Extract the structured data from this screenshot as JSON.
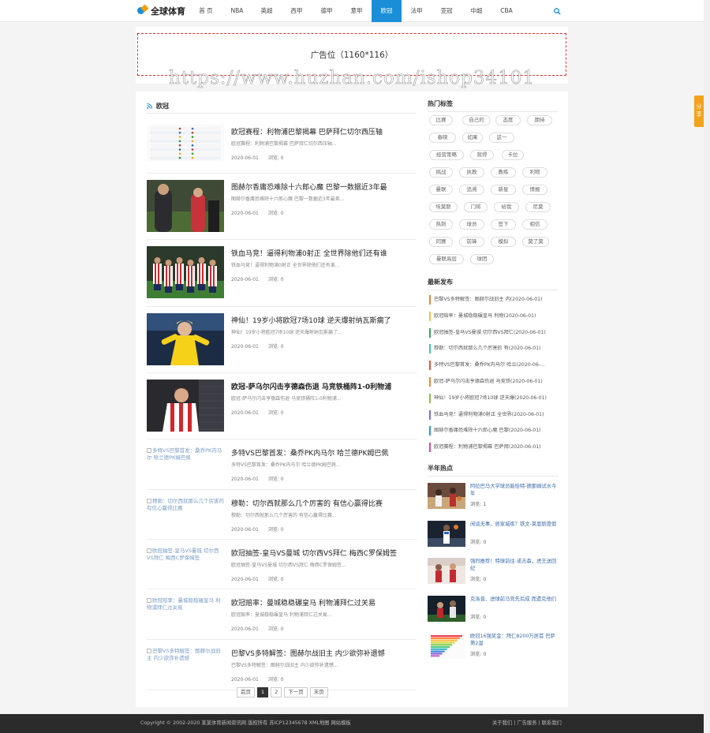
{
  "header": {
    "logo_text": "全球体育",
    "nav": [
      "首 页",
      "NBA",
      "英超",
      "西甲",
      "德甲",
      "意甲",
      "欧冠",
      "法甲",
      "亚冠",
      "中超",
      "CBA"
    ],
    "active_nav": "欧冠"
  },
  "ad": {
    "label": "广告位（1160*116）"
  },
  "watermark": "https://www.huzhan.com/ishop34101",
  "section": {
    "title": "欧冠"
  },
  "posts": [
    {
      "title": "欧冠赛程：利物浦巴黎揭幕 巴萨拜仁切尔西压轴",
      "desc": "欧冠赛程：利物浦巴黎揭幕 巴萨拜仁切尔西压轴...",
      "date": "2020-06-01",
      "views": "浏览: 0",
      "bold": false,
      "image": "table",
      "alt": ""
    },
    {
      "title": "图赫尔香庸恐难除十六郎心魔 巴黎一数据近3年最",
      "desc": "图赫尔香庸恐难除十六郎心魔 巴黎一数据近3年最差...",
      "date": "2020-06-01",
      "views": "浏览: 0",
      "bold": false,
      "image": "coach",
      "alt": ""
    },
    {
      "title": "铁血马竞！逼得利物浦0射正 全世界除他们还有谁",
      "desc": "铁血马竞！逼得利物浦0射正 全世界除他们还有谁...",
      "date": "2020-06-01",
      "views": "浏览: 0",
      "bold": false,
      "image": "team",
      "alt": ""
    },
    {
      "title": "神仙！19岁小将欧冠7场10球 逆天爆射纳瓦斯瘸了",
      "desc": "神仙！19岁小将欧冠7场10球 逆天爆射纳瓦斯瘸了...",
      "date": "2020-06-01",
      "views": "浏览: 0",
      "bold": false,
      "image": "player-yellow",
      "alt": ""
    },
    {
      "title": "欧冠-萨乌尔闪击亨德森伤退 马竞铁桶阵1-0利物浦",
      "desc": "欧冠-萨乌尔闪击亨德森伤退 马竞铁桶阵1-0利物浦...",
      "date": "2020-06-01",
      "views": "浏览: 0",
      "bold": true,
      "image": "player-stripes",
      "alt": ""
    },
    {
      "title": "多特VS巴黎首发：桑乔PK内马尔 哈兰德PK姆巴佩",
      "desc": "多特VS巴黎首发：桑乔PK内马尔 哈兰德PK姆巴佩...",
      "date": "2020-06-01",
      "views": "浏览: 0",
      "bold": false,
      "image": "",
      "alt": "多特VS巴黎首发：桑乔PK内马尔 哈兰德PK姆巴佩"
    },
    {
      "title": "穆勒：切尔西就那么几个厉害的 有信心赢得比赛",
      "desc": "穆勒：切尔西就那么几个厉害的 有信心赢得比赛...",
      "date": "2020-06-01",
      "views": "浏览: 0",
      "bold": false,
      "image": "",
      "alt": "穆勒：切尔西就那么几个厉害的 有信心赢得比赛"
    },
    {
      "title": "欧冠抽签-皇马VS曼城 切尔西VS拜仁 梅西C罗保姆签",
      "desc": "欧冠抽签-皇马VS曼城 切尔西VS拜仁 梅西C罗保姆签...",
      "date": "2020-06-01",
      "views": "浏览: 0",
      "bold": false,
      "image": "",
      "alt": "欧冠抽签-皇马VS曼城 切尔西VS拜仁 梅西C罗保姆签"
    },
    {
      "title": "欧冠赔率：曼城稳稳碾皇马 利物浦拜仁过关易",
      "desc": "欧冠赔率：曼城稳稳碾皇马 利物浦拜仁过关易...",
      "date": "2020-06-01",
      "views": "浏览: 0",
      "bold": false,
      "image": "",
      "alt": "欧冠赔率：曼城稳稳碾皇马 利物浦拜仁过关易"
    },
    {
      "title": "巴黎VS多特解签：图赫尔战旧主 内少欲弥补遗憾",
      "desc": "巴黎VS多特解签：图赫尔战旧主 内少欲弥补遗憾...",
      "date": "2020-06-01",
      "views": "浏览: 0",
      "bold": false,
      "image": "",
      "alt": "巴黎VS多特解签：图赫尔战旧主 内少欲弥补遗憾"
    }
  ],
  "pagination": [
    "首页",
    "1",
    "2",
    "下一页",
    "末页"
  ],
  "sidebar": {
    "tags_title": "热门标签",
    "tags": [
      "比赛",
      "自己的",
      "态度",
      "期待",
      "春晓",
      "如果",
      "这一",
      "经营策略",
      "就得",
      "卡拉",
      "挑战",
      "执教",
      "教练",
      "利物",
      "曼联",
      "追溯",
      "新星",
      "情报",
      "埃莫斯",
      "门将",
      "给我",
      "尼莫",
      "热刺",
      "球员",
      "签下",
      "相信",
      "同赛",
      "前锋",
      "模拟",
      "莫了莫",
      "曼联高层",
      "球团"
    ],
    "latest_title": "最新发布",
    "latest": [
      {
        "text": "巴黎VS多特解签：图赫尔战旧主 内(2020-06-01)",
        "color": "#e9883a"
      },
      {
        "text": "欧冠赔率：曼城稳稳碾皇马 利物(2020-06-01)",
        "color": "#f2c14e"
      },
      {
        "text": "欧冠抽签-皇马VS曼城 切尔西VS拜仁(2020-06-01)",
        "color": "#3aa657"
      },
      {
        "text": "穆勒：切尔西就那么几个厉害的 有(2020-06-01)",
        "color": "#3dbfd1"
      },
      {
        "text": "多特VS巴黎首发：桑乔PK内马尔 哈兰(2020-06-...",
        "color": "#e2543c"
      },
      {
        "text": "欧冠-萨乌尔闪击亨德森伤退 马竞铁(2020-06-01)",
        "color": "#ee8a2f"
      },
      {
        "text": "神仙！19岁小将欧冠7场10球 逆天爆(2020-06-01)",
        "color": "#8bc34a"
      },
      {
        "text": "铁血马竞！逼得利物浦0射正 全世界(2020-06-01)",
        "color": "#7a6fd0"
      },
      {
        "text": "图赫尔香庸恐难除十六郎心魔 巴黎(2020-06-01)",
        "color": "#2d9ad7"
      },
      {
        "text": "欧冠赛程：利物浦巴黎揭幕 巴萨拜(2020-06-01)",
        "color": "#d94aa6"
      }
    ],
    "hot_title": "半年热点",
    "hot": [
      {
        "title": "阿拉巴马大学球员能恰特-德那姆试水今年",
        "views": "浏览: 1",
        "image": "basketball-crowd"
      },
      {
        "title": "闲谈无事，居家城练？铁文-莱恩斯度假",
        "views": "浏览: 0",
        "image": "basketball-dark"
      },
      {
        "title": "强烈推荐！特球前往-诺吉森，虎王送回纪",
        "views": "浏览: 0",
        "image": "basketball-red"
      },
      {
        "title": "克洛普、进球前马竞先后成 而遗克他们",
        "views": "浏览: 0",
        "image": "soccer-dark"
      },
      {
        "title": "欧冠16强奖金：拜仁8200万居首 巴萨第2湿",
        "views": "浏览: 0",
        "image": "chart"
      }
    ]
  },
  "share": {
    "label": "分享"
  },
  "footer": {
    "copyright": "Copyright © 2002-2020 某某体育新闻资讯网 版权所有 苏ICP12345678 XML地图 网站模板",
    "links": [
      "关于我们",
      "广告服务",
      "联系我们"
    ],
    "separator": " | "
  }
}
